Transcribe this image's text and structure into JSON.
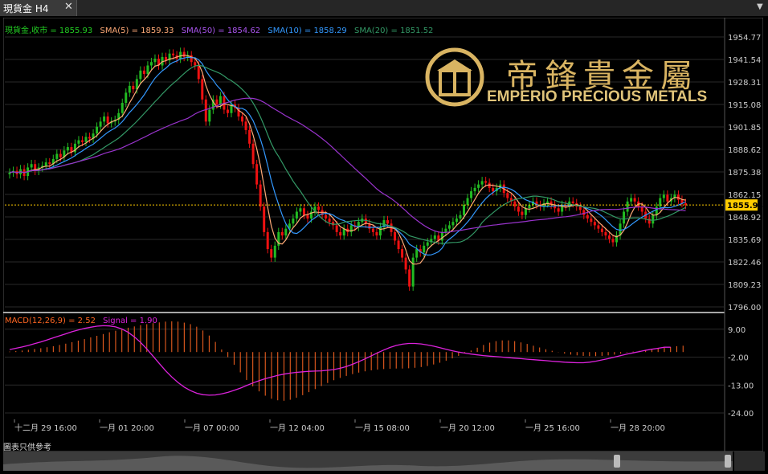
{
  "tab": {
    "label": "現貨金 H4",
    "close": "✕"
  },
  "legend": {
    "symbol": "現貨金,收市 = 1855.93",
    "sma5": "SMA(5) = 1859.33",
    "sma50": "SMA(50) = 1854.62",
    "sma10": "SMA(10) = 1858.29",
    "sma20": "SMA(20) = 1851.52"
  },
  "macd_legend": {
    "macd": "MACD(12,26,9) = 2.52",
    "signal": "Signal = 1.90"
  },
  "logo": {
    "chinese": "帝鋒貴金屬",
    "english": "EMPERIO PRECIOUS METALS"
  },
  "footer_note": "圖表只供參考",
  "colors": {
    "up": "#22bb22",
    "down": "#ee1111",
    "sma5": "#ffaa77",
    "sma10": "#3399ff",
    "sma20": "#339966",
    "sma50": "#9933cc",
    "macd": "#ff6622",
    "signal": "#dd22dd",
    "price_line": "#ffcc00"
  },
  "chart_data": [
    {
      "type": "candlestick",
      "title": "現貨金 H4",
      "ylim": [
        1796.0,
        1954.77
      ],
      "y_ticks": [
        "1954.77",
        "1941.54",
        "1928.31",
        "1915.08",
        "1901.85",
        "1888.62",
        "1875.38",
        "1862.15",
        "1848.92",
        "1835.69",
        "1822.46",
        "1809.23",
        "1796.00"
      ],
      "current_price": "1855.93",
      "x_ticks": [
        "十二月 29 16:00",
        "一月 01 20:00",
        "一月 07 00:00",
        "一月 12 04:00",
        "一月 15 08:00",
        "一月 20 12:00",
        "一月 25 16:00",
        "一月 28 20:00"
      ],
      "close_series": [
        1875,
        1876,
        1874,
        1877,
        1873,
        1878,
        1880,
        1876,
        1878,
        1879,
        1881,
        1880,
        1883,
        1886,
        1884,
        1888,
        1890,
        1887,
        1892,
        1894,
        1893,
        1896,
        1895,
        1898,
        1902,
        1905,
        1908,
        1904,
        1905,
        1906,
        1910,
        1916,
        1922,
        1926,
        1924,
        1930,
        1935,
        1933,
        1938,
        1940,
        1942,
        1938,
        1943,
        1941,
        1945,
        1944,
        1942,
        1946,
        1943,
        1944,
        1940,
        1938,
        1930,
        1918,
        1905,
        1912,
        1918,
        1915,
        1920,
        1912,
        1910,
        1915,
        1913,
        1908,
        1905,
        1900,
        1892,
        1880,
        1868,
        1855,
        1840,
        1830,
        1825,
        1832,
        1840,
        1838,
        1842,
        1845,
        1848,
        1852,
        1854,
        1850,
        1848,
        1852,
        1855,
        1853,
        1850,
        1848,
        1846,
        1844,
        1840,
        1838,
        1842,
        1840,
        1844,
        1843,
        1846,
        1848,
        1845,
        1842,
        1840,
        1838,
        1843,
        1847,
        1845,
        1840,
        1835,
        1830,
        1825,
        1818,
        1808,
        1825,
        1830,
        1828,
        1832,
        1834,
        1836,
        1838,
        1835,
        1840,
        1842,
        1844,
        1846,
        1848,
        1850,
        1856,
        1860,
        1864,
        1866,
        1868,
        1870,
        1869,
        1866,
        1864,
        1866,
        1868,
        1863,
        1860,
        1858,
        1855,
        1852,
        1850,
        1854,
        1856,
        1858,
        1856,
        1855,
        1857,
        1858,
        1856,
        1854,
        1852,
        1856,
        1855,
        1858,
        1857,
        1855,
        1853,
        1850,
        1848,
        1846,
        1844,
        1842,
        1840,
        1838,
        1836,
        1834,
        1838,
        1845,
        1852,
        1858,
        1860,
        1858,
        1855,
        1852,
        1848,
        1845,
        1850,
        1855,
        1860,
        1862,
        1858,
        1860,
        1862,
        1859,
        1857,
        1856
      ],
      "macd_ylim": [
        -24.0,
        14.0
      ],
      "macd_y_ticks": [
        "9.00",
        "-2.00",
        "-13.00",
        "-24.00"
      ],
      "macd_hist": [
        0.2,
        0.4,
        0.6,
        0.9,
        1.2,
        1.5,
        1.9,
        2.3,
        2.8,
        3.3,
        3.9,
        4.5,
        5.1,
        5.8,
        6.4,
        7.1,
        7.8,
        8.4,
        9.0,
        9.6,
        10.1,
        10.6,
        11.0,
        11.4,
        11.7,
        12.0,
        12.1,
        12.0,
        11.6,
        11.0,
        10.0,
        8.5,
        6.5,
        4.0,
        1.0,
        -2.0,
        -5.0,
        -8.0,
        -11.0,
        -13.5,
        -15.5,
        -17.2,
        -18.4,
        -19.0,
        -19.2,
        -18.8,
        -18.0,
        -17.0,
        -15.8,
        -14.6,
        -13.4,
        -12.2,
        -11.1,
        -10.2,
        -9.4,
        -8.7,
        -8.1,
        -7.6,
        -7.2,
        -6.9,
        -6.7,
        -6.6,
        -6.5,
        -6.5,
        -6.4,
        -6.2,
        -5.9,
        -5.5,
        -4.9,
        -4.2,
        -3.4,
        -2.5,
        -1.5,
        -0.5,
        0.6,
        1.7,
        2.8,
        3.7,
        4.3,
        4.6,
        4.6,
        4.3,
        3.8,
        3.2,
        2.5,
        1.8,
        1.1,
        0.5,
        -0.1,
        -0.6,
        -1.0,
        -1.3,
        -1.5,
        -1.6,
        -1.6,
        -1.5,
        -1.3,
        -1.0,
        -0.6,
        -0.2,
        0.2,
        0.5,
        0.8,
        1.1,
        1.4,
        1.7,
        2.0,
        2.3,
        2.5
      ],
      "macd_signal": [
        1.0,
        1.5,
        2.0,
        2.6,
        3.3,
        4.0,
        4.8,
        5.6,
        6.4,
        7.2,
        8.0,
        8.7,
        9.3,
        9.8,
        10.2,
        10.4,
        10.3,
        9.9,
        9.1,
        7.8,
        6.0,
        3.8,
        1.2,
        -1.6,
        -4.5,
        -7.3,
        -9.8,
        -12.0,
        -13.8,
        -15.2,
        -16.2,
        -16.8,
        -17.0,
        -16.9,
        -16.5,
        -15.9,
        -15.1,
        -14.2,
        -13.2,
        -12.2,
        -11.3,
        -10.5,
        -9.8,
        -9.2,
        -8.7,
        -8.3,
        -8.0,
        -7.8,
        -7.6,
        -7.5,
        -7.4,
        -7.2,
        -6.9,
        -6.4,
        -5.7,
        -4.8,
        -3.8,
        -2.7,
        -1.5,
        -0.3,
        0.8,
        1.8,
        2.6,
        3.1,
        3.4,
        3.4,
        3.2,
        2.8,
        2.3,
        1.7,
        1.1,
        0.5,
        0.0,
        -0.4,
        -0.8,
        -1.1,
        -1.4,
        -1.6,
        -1.8,
        -2.0,
        -2.2,
        -2.4,
        -2.6,
        -2.8,
        -3.0,
        -3.2,
        -3.4,
        -3.6,
        -3.8,
        -4.0,
        -4.1,
        -4.2,
        -4.2,
        -4.0,
        -3.6,
        -3.1,
        -2.6,
        -2.0,
        -1.4,
        -0.8,
        -0.3,
        0.2,
        0.7,
        1.1,
        1.5,
        1.9,
        1.9
      ]
    }
  ]
}
